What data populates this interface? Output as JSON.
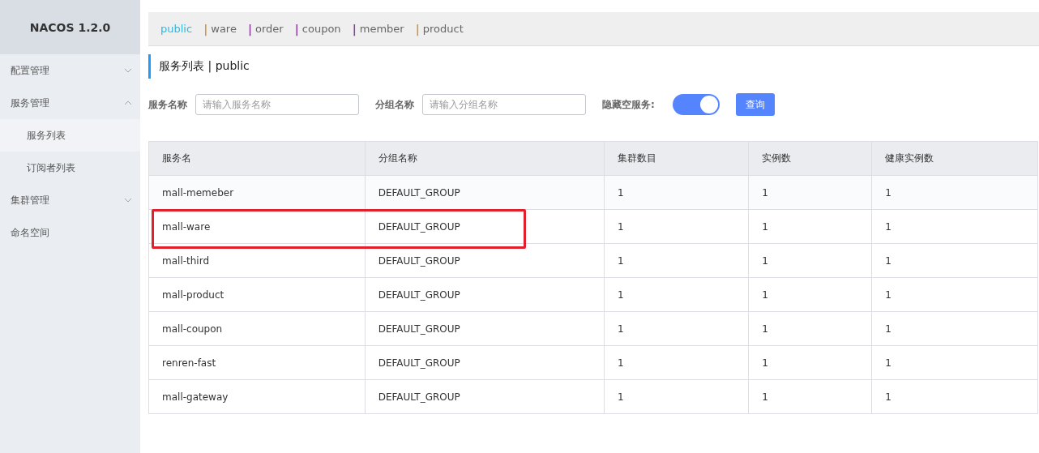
{
  "sidebar": {
    "title": "NACOS 1.2.0",
    "items": [
      {
        "label": "配置管理",
        "expanded": false
      },
      {
        "label": "服务管理",
        "expanded": true,
        "children": [
          {
            "label": "服务列表",
            "selected": true
          },
          {
            "label": "订阅者列表",
            "selected": false
          }
        ]
      },
      {
        "label": "集群管理",
        "expanded": false
      },
      {
        "label": "命名空间"
      }
    ]
  },
  "namespaces": [
    {
      "label": "public",
      "selected": true
    },
    {
      "separator": "|",
      "label": "ware",
      "selected": false,
      "color": "#c9974a"
    },
    {
      "separator": "|",
      "label": "order",
      "selected": false,
      "color": "#8b3fa0"
    },
    {
      "separator": "|",
      "label": "coupon",
      "selected": false,
      "color": "#8b3fa0"
    },
    {
      "separator": "|",
      "label": "member",
      "selected": false,
      "color": "#8b3fa0"
    },
    {
      "separator": "|",
      "label": "product",
      "selected": false,
      "color": "#c9974a"
    }
  ],
  "page_title": {
    "title": "服务列表",
    "separator": "|",
    "namespace": "public"
  },
  "filters": {
    "service_label": "服务名称",
    "service_placeholder": "请输入服务名称",
    "group_label": "分组名称",
    "group_placeholder": "请输入分组名称",
    "hide_empty_label": "隐藏空服务:",
    "hide_empty_on": true,
    "query_button": "查询"
  },
  "table": {
    "columns": [
      "服务名",
      "分组名称",
      "集群数目",
      "实例数",
      "健康实例数"
    ],
    "rows": [
      {
        "cells": [
          "mall-memeber",
          "DEFAULT_GROUP",
          "1",
          "1",
          "1"
        ],
        "highlighted": false
      },
      {
        "cells": [
          "mall-ware",
          "DEFAULT_GROUP",
          "1",
          "1",
          "1"
        ],
        "highlighted": true
      },
      {
        "cells": [
          "mall-third",
          "DEFAULT_GROUP",
          "1",
          "1",
          "1"
        ],
        "highlighted": false
      },
      {
        "cells": [
          "mall-product",
          "DEFAULT_GROUP",
          "1",
          "1",
          "1"
        ],
        "highlighted": false
      },
      {
        "cells": [
          "mall-coupon",
          "DEFAULT_GROUP",
          "1",
          "1",
          "1"
        ],
        "highlighted": false
      },
      {
        "cells": [
          "renren-fast",
          "DEFAULT_GROUP",
          "1",
          "1",
          "1"
        ],
        "highlighted": false
      },
      {
        "cells": [
          "mall-gateway",
          "DEFAULT_GROUP",
          "1",
          "1",
          "1"
        ],
        "highlighted": false
      }
    ]
  }
}
